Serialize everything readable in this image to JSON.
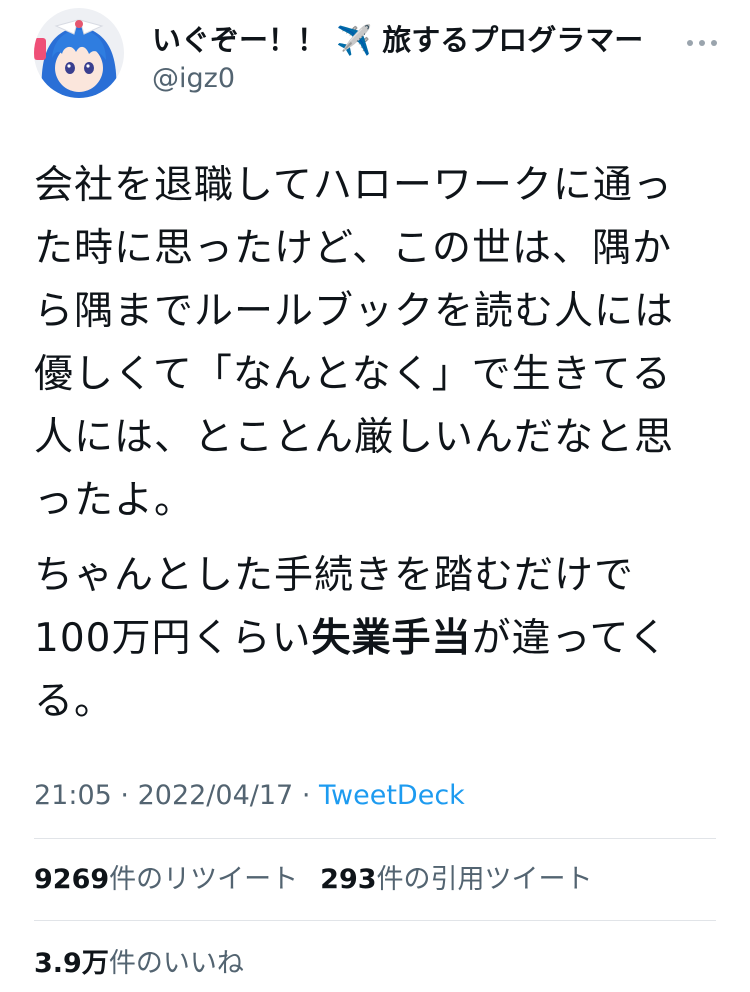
{
  "author": {
    "display_name": "いぐぞー！！ ✈️ 旅するプログラマー",
    "handle": "@igz0",
    "avatar_icon": "anime-avatar-icon"
  },
  "menu": {
    "more_icon": "more-dots-icon"
  },
  "tweet": {
    "paragraph1": [
      "会社を退職してハローワークに通っ",
      "た時に思ったけど、この世は、隅か",
      "ら隅までルールブックを読む人には",
      "優しくて「なんとなく」で生きてる",
      "人には、とことん厳しいんだなと思",
      "ったよ。"
    ],
    "paragraph2": {
      "line1": "ちゃんとした手続きを踏むだけで",
      "line2_before": "100万円くらい",
      "line2_bold": "失業手当",
      "line2_after": "が違ってく",
      "line3": "る。"
    }
  },
  "meta": {
    "time": "21:05",
    "separator": "·",
    "date": "2022/04/17",
    "source": "TweetDeck"
  },
  "stats": {
    "retweets": {
      "count": "9269",
      "label": "件のリツイート"
    },
    "quotes": {
      "count": "293",
      "label": "件の引用ツイート"
    },
    "likes": {
      "count": "3.9万",
      "label": "件のいいね"
    }
  },
  "colors": {
    "text": "#0f1419",
    "secondary": "#536471",
    "link": "#1d9bf0",
    "divider": "#e1e4e8"
  }
}
